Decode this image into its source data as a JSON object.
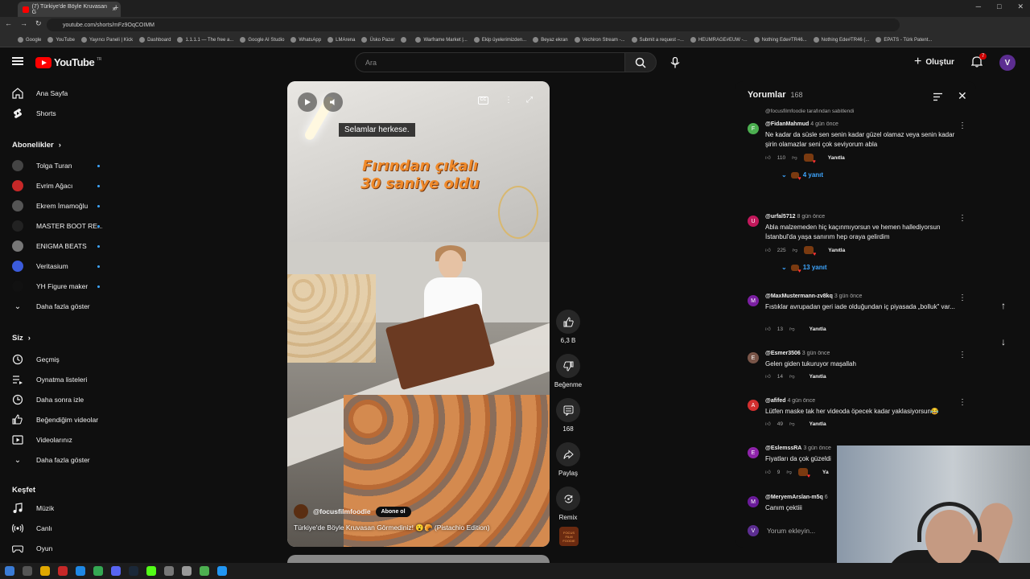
{
  "browser": {
    "tab_title": "(7) Türkiye'de Böyle Kruvasan G",
    "url": "youtube.com/shorts/mFz9OqCOIMM",
    "bookmarks": [
      "Google",
      "YouTube",
      "Yayıncı Paneli | Kick",
      "Dashboard",
      "1.1.1.1 — The free a...",
      "Google AI Studio",
      "WhatsApp",
      "LMArena",
      "Üsko Pazar",
      "",
      "Warframe Market |...",
      "Ekip üyelerimizden...",
      "Beyaz ekran",
      "Vechiron Stream -...",
      "Submit a request –...",
      "HEUMRAGE#EUW -...",
      "Nothing Ede#TR46...",
      "Nothing Ede#TR46 (...",
      "EPATS - Türk Patent..."
    ]
  },
  "header": {
    "logo_text": "YouTube",
    "logo_region": "TR",
    "search_placeholder": "Ara",
    "create_label": "Oluştur",
    "notif_count": "7",
    "avatar_letter": "V"
  },
  "sidebar": {
    "main": [
      {
        "label": "Ana Sayfa",
        "icon": "home-icon"
      },
      {
        "label": "Shorts",
        "icon": "shorts-icon"
      }
    ],
    "subs_title": "Abonelikler",
    "subs": [
      {
        "label": "Tolga Turan",
        "color": "#444444"
      },
      {
        "label": "Evrim Ağacı",
        "color": "#c62828"
      },
      {
        "label": "Ekrem İmamoğlu",
        "color": "#555555"
      },
      {
        "label": "MASTER BOOT RE...",
        "color": "#222222"
      },
      {
        "label": "ENIGMA BEATS",
        "color": "#777777"
      },
      {
        "label": "Veritasium",
        "color": "#3b5bdb"
      },
      {
        "label": "YH Figure maker",
        "color": "#111111"
      }
    ],
    "subs_more": "Daha fazla göster",
    "you_title": "Siz",
    "you": [
      {
        "label": "Geçmiş",
        "icon": "history-icon"
      },
      {
        "label": "Oynatma listeleri",
        "icon": "playlist-icon"
      },
      {
        "label": "Daha sonra izle",
        "icon": "clock-icon"
      },
      {
        "label": "Beğendiğim videolar",
        "icon": "like-icon"
      },
      {
        "label": "Videolarınız",
        "icon": "video-icon"
      }
    ],
    "you_more": "Daha fazla göster",
    "explore_title": "Keşfet",
    "explore": [
      {
        "label": "Müzik",
        "icon": "music-icon"
      },
      {
        "label": "Canlı",
        "icon": "live-icon"
      },
      {
        "label": "Oyun",
        "icon": "game-icon"
      }
    ]
  },
  "video": {
    "caption": "Selamlar herkese.",
    "overlay_line1": "Fırından çıkalı",
    "overlay_line2": "30 saniye oldu",
    "channel": "@focusfilmfoodie",
    "subscribe": "Abone ol",
    "title": "Türkiye'de Böyle Kruvasan Görmediniz! 😮🥐 (Pistachio Edition)",
    "cc_label": "CC",
    "thumb_text": "FOCUS FILM FOODIE"
  },
  "actions": {
    "likes": "6,3 B",
    "dislike": "Beğenme",
    "comments": "168",
    "share": "Paylaş",
    "remix": "Remix"
  },
  "comments_panel": {
    "title": "Yorumlar",
    "count": "168",
    "input_placeholder": "Yorum ekleyin...",
    "input_avatar": "V",
    "items": [
      {
        "pinned": "@focusfilmfoodie tarafından sabitlendi",
        "user": "@FidanMahmud",
        "time": "4 gün önce",
        "text": "Ne kadar da süsle sen senin kadar güzel olamaz veya senin kadar şirin olamazlar seni çok seviyorum abla",
        "likes": "110",
        "reply": "Yanıtla",
        "replies": "4 yanıt",
        "avatar": "F",
        "color": "#4caf50",
        "hearted": true
      },
      {
        "pinned": "",
        "user": "@urfal5712",
        "time": "8 gün önce",
        "text": "Abla malzemeden hiç kaçınmıyorsun ve hemen hallediyorsun İstanbul'da yaşa sanırım hep oraya gelirdim",
        "likes": "225",
        "reply": "Yanıtla",
        "replies": "13 yanıt",
        "avatar": "U",
        "color": "#c2185b",
        "hearted": true
      },
      {
        "pinned": "",
        "user": "@MaxMustermann-zv8kq",
        "time": "3 gün önce",
        "text": "Fıstıklar avrupadan geri iade olduğundan iç piyasada „bolluk\" var...",
        "likes": "13",
        "reply": "Yanıtla",
        "replies": "",
        "avatar": "M",
        "color": "#7b1fa2",
        "hearted": false
      },
      {
        "pinned": "",
        "user": "@Esmer3506",
        "time": "3 gün önce",
        "text": "Gelen giden tukuruyor maşallah",
        "likes": "14",
        "reply": "Yanıtla",
        "replies": "",
        "avatar": "E",
        "color": "#795548",
        "hearted": false
      },
      {
        "pinned": "",
        "user": "@afifed",
        "time": "4 gün önce",
        "text": "Lütfen maske tak her videoda öpecek kadar yaklasiyorsun😂",
        "likes": "49",
        "reply": "Yanıtla",
        "replies": "",
        "avatar": "A",
        "color": "#d32f2f",
        "hearted": false
      },
      {
        "pinned": "",
        "user": "@EslemssRA",
        "time": "3 gün önce",
        "text": "Fiyatları da çok güzeldi",
        "likes": "9",
        "reply": "Ya",
        "replies": "",
        "avatar": "E",
        "color": "#8e24aa",
        "hearted": true
      },
      {
        "pinned": "",
        "user": "@MeryemArslan-m5q",
        "time": "6",
        "text": "Canım çektiii",
        "likes": "",
        "reply": "",
        "replies": "",
        "avatar": "M",
        "color": "#6a1b9a",
        "hearted": false
      }
    ]
  },
  "nav_arrows": {
    "up": "↑",
    "down": "↓"
  }
}
